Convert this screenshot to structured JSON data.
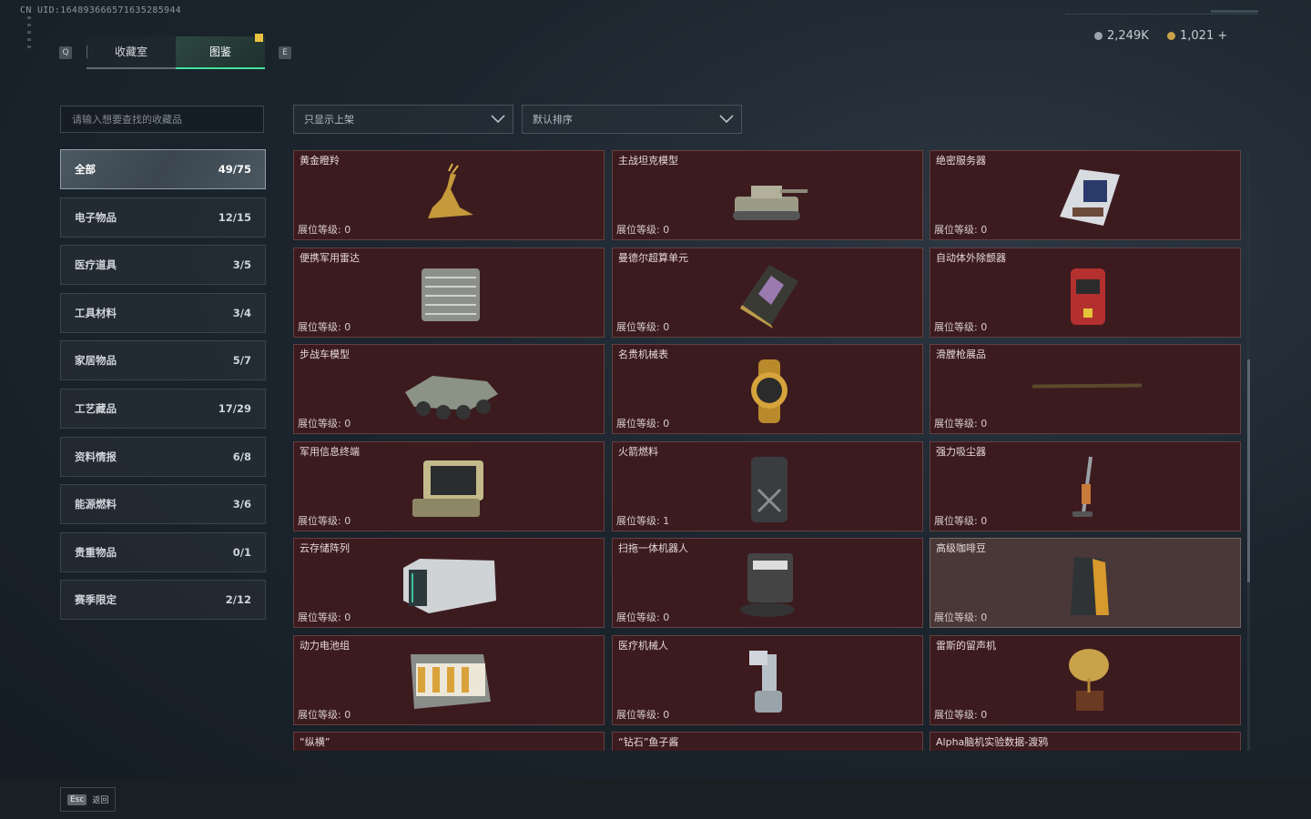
{
  "header": {
    "uid": "CN UID:164893666571635285944",
    "tab_left_key": "Q",
    "tab_right_key": "E",
    "tabs": [
      {
        "label": "收藏室"
      },
      {
        "label": "图鉴"
      }
    ],
    "currency": [
      {
        "value": "2,249K",
        "color": "#9aa4ae"
      },
      {
        "value": "1,021 +",
        "color": "#c9a24a"
      }
    ]
  },
  "filters": {
    "search_placeholder": "请输入想要查找的收藏品",
    "shelf_filter": "只显示上架",
    "sort": "默认排序"
  },
  "sidebar": {
    "items": [
      {
        "label": "全部",
        "count": "49/75",
        "active": true
      },
      {
        "label": "电子物品",
        "count": "12/15"
      },
      {
        "label": "医疗道具",
        "count": "3/5"
      },
      {
        "label": "工具材料",
        "count": "3/4"
      },
      {
        "label": "家居物品",
        "count": "5/7"
      },
      {
        "label": "工艺藏品",
        "count": "17/29"
      },
      {
        "label": "资料情报",
        "count": "6/8"
      },
      {
        "label": "能源燃料",
        "count": "3/6"
      },
      {
        "label": "贵重物品",
        "count": "0/1"
      },
      {
        "label": "赛季限定",
        "count": "2/12"
      }
    ]
  },
  "grid": {
    "items": [
      {
        "name": "黄金瞪羚",
        "level": "展位等级: 0",
        "icon": "golden-gazelle-icon"
      },
      {
        "name": "主战坦克模型",
        "level": "展位等级: 0",
        "icon": "tank-model-icon"
      },
      {
        "name": "绝密服务器",
        "level": "展位等级: 0",
        "icon": "server-icon"
      },
      {
        "name": "便携军用雷达",
        "level": "展位等级: 0",
        "icon": "radar-icon"
      },
      {
        "name": "曼德尔超算单元",
        "level": "展位等级: 0",
        "icon": "compute-unit-icon"
      },
      {
        "name": "自动体外除颤器",
        "level": "展位等级: 0",
        "icon": "defibrillator-icon"
      },
      {
        "name": "步战车模型",
        "level": "展位等级: 0",
        "icon": "ifv-model-icon"
      },
      {
        "name": "名贵机械表",
        "level": "展位等级: 0",
        "icon": "watch-icon"
      },
      {
        "name": "滑膛枪展品",
        "level": "展位等级: 0",
        "icon": "musket-icon"
      },
      {
        "name": "军用信息终端",
        "level": "展位等级: 0",
        "icon": "terminal-icon"
      },
      {
        "name": "火箭燃料",
        "level": "展位等级: 1",
        "icon": "fuel-can-icon"
      },
      {
        "name": "强力吸尘器",
        "level": "展位等级: 0",
        "icon": "vacuum-icon"
      },
      {
        "name": "云存储阵列",
        "level": "展位等级: 0",
        "icon": "storage-array-icon"
      },
      {
        "name": "扫拖一体机器人",
        "level": "展位等级: 0",
        "icon": "robot-vacuum-icon"
      },
      {
        "name": "高级咖啡豆",
        "level": "展位等级: 0",
        "icon": "coffee-bag-icon",
        "highlight": true
      },
      {
        "name": "动力电池组",
        "level": "展位等级: 0",
        "icon": "battery-pack-icon"
      },
      {
        "name": "医疗机械人",
        "level": "展位等级: 0",
        "icon": "medical-robot-icon"
      },
      {
        "name": "雷斯的留声机",
        "level": "展位等级: 0",
        "icon": "gramophone-icon"
      },
      {
        "name": "“纵横”",
        "level": "",
        "icon": ""
      },
      {
        "name": "“钻石”鱼子酱",
        "level": "",
        "icon": ""
      },
      {
        "name": "Alpha脑机实验数据-渡鸦",
        "level": "",
        "icon": ""
      }
    ]
  },
  "footer": {
    "key": "Esc",
    "label": "返回"
  }
}
